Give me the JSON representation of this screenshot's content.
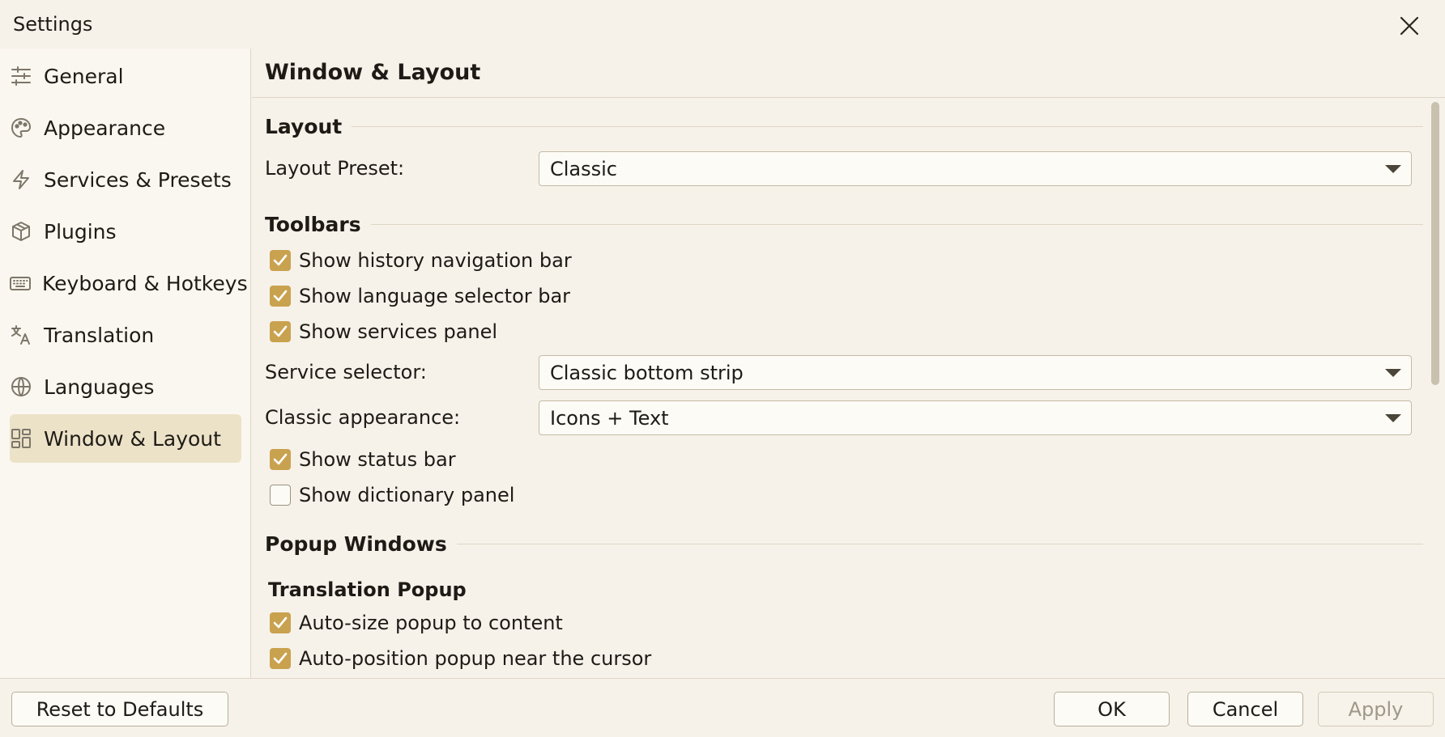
{
  "window": {
    "title": "Settings"
  },
  "sidebar": {
    "items": [
      {
        "label": "General",
        "icon": "sliders-icon"
      },
      {
        "label": "Appearance",
        "icon": "palette-icon"
      },
      {
        "label": "Services & Presets",
        "icon": "lightning-icon"
      },
      {
        "label": "Plugins",
        "icon": "package-icon"
      },
      {
        "label": "Keyboard & Hotkeys",
        "icon": "keyboard-icon"
      },
      {
        "label": "Translation",
        "icon": "translate-icon"
      },
      {
        "label": "Languages",
        "icon": "globe-icon"
      },
      {
        "label": "Window & Layout",
        "icon": "layout-icon",
        "active": true
      }
    ]
  },
  "page": {
    "title": "Window & Layout",
    "layout": {
      "heading": "Layout",
      "preset_label": "Layout Preset:",
      "preset_value": "Classic"
    },
    "toolbars": {
      "heading": "Toolbars",
      "history_bar": {
        "label": "Show history navigation bar",
        "checked": true
      },
      "language_bar": {
        "label": "Show language selector bar",
        "checked": true
      },
      "services_panel": {
        "label": "Show services panel",
        "checked": true
      },
      "service_selector_label": "Service selector:",
      "service_selector_value": "Classic bottom strip",
      "classic_appearance_label": "Classic appearance:",
      "classic_appearance_value": "Icons + Text",
      "status_bar": {
        "label": "Show status bar",
        "checked": true
      },
      "dictionary_panel": {
        "label": "Show dictionary panel",
        "checked": false
      }
    },
    "popup": {
      "heading": "Popup Windows",
      "translation_popup_heading": "Translation Popup",
      "auto_size": {
        "label": "Auto-size popup to content",
        "checked": true
      },
      "auto_position": {
        "label": "Auto-position popup near the cursor",
        "checked": true
      }
    }
  },
  "footer": {
    "reset_label": "Reset to Defaults",
    "ok_label": "OK",
    "cancel_label": "Cancel",
    "apply_label": "Apply"
  },
  "colors": {
    "accent": "#c9a24f",
    "active_nav_bg": "#ece2c8",
    "background": "#f6f2ea"
  }
}
